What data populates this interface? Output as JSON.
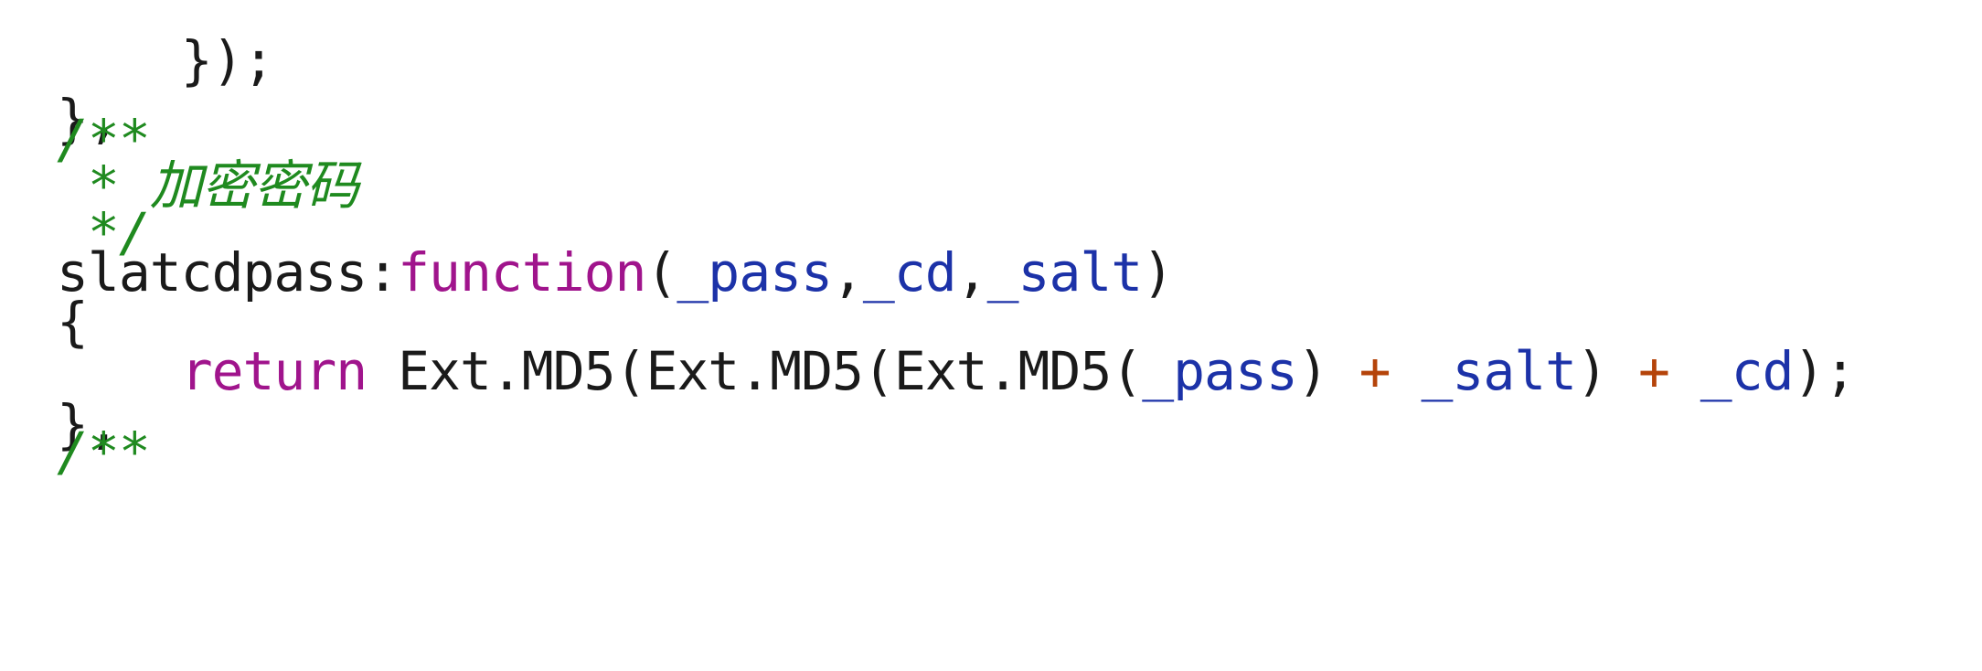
{
  "code": {
    "line1": {
      "indent": "    ",
      "text": "});"
    },
    "line2": {
      "text": "},"
    },
    "line3": {
      "comment": "/**"
    },
    "line4": {
      "comment": " * 加密密码"
    },
    "line5": {
      "comment": " */"
    },
    "line6": {
      "name": "slatcdpass:",
      "keyword": "function",
      "open": "(",
      "p1": "_pass",
      "c1": ",",
      "p2": "_cd",
      "c2": ",",
      "p3": "_salt",
      "close": ")"
    },
    "line7": {
      "text": "{"
    },
    "line8": {
      "indent": "    ",
      "keyword": "return",
      "t1": " Ext.MD5(Ext.MD5(Ext.MD5(",
      "p1": "_pass",
      "t2": ") ",
      "op1": "+",
      "t3": " ",
      "p2": "_salt",
      "t4": ") ",
      "op2": "+",
      "t5": " ",
      "p3": "_cd",
      "t6": ");"
    },
    "line9": {
      "text": "},"
    },
    "line10": {
      "comment": "/**"
    }
  },
  "colors": {
    "comment": "#1f8a1f",
    "keyword": "#a0148c",
    "parameter": "#1c32a8",
    "operator": "#b5440a",
    "text": "#1a1a1a",
    "background": "#ffffff"
  }
}
